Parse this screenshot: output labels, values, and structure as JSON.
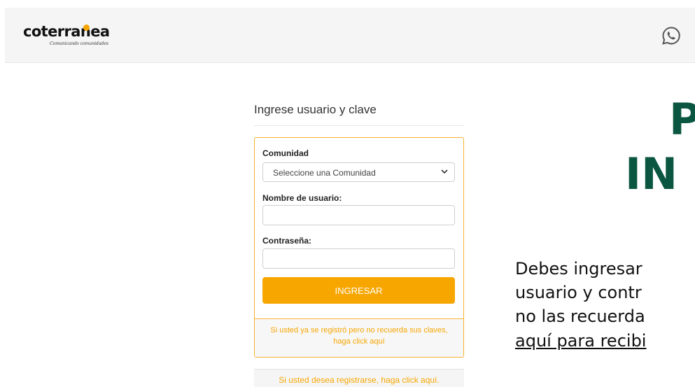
{
  "brand": {
    "name": "coterranea",
    "tagline": "Comunicando comunidades",
    "accent": "#f7a600"
  },
  "header": {
    "whatsapp_icon": "whatsapp-icon"
  },
  "login": {
    "title": "Ingrese usuario y clave",
    "community_label": "Comunidad",
    "community_selected": "Seleccione una Comunidad",
    "username_label": "Nombre de usuario:",
    "username_value": "",
    "password_label": "Contraseña:",
    "password_value": "",
    "submit_label": "INGRESAR",
    "forgot_line1": "Si usted ya se registró pero no recuerda sus claves,",
    "forgot_line2": "haga click aquí",
    "register_text": "Si usted desea registrarse, haga click aquí."
  },
  "hero": {
    "title_line1": "P",
    "title_line2": "IN",
    "text_line1": "Debes ingresar",
    "text_line2": "usuario y contr",
    "text_line3": "no las recuerda",
    "link_text": "aquí para recibi",
    "title_color": "#0b5640"
  },
  "colors": {
    "accent": "#f7a600",
    "link_orange": "#f7a600",
    "hero_green": "#0b5640"
  }
}
